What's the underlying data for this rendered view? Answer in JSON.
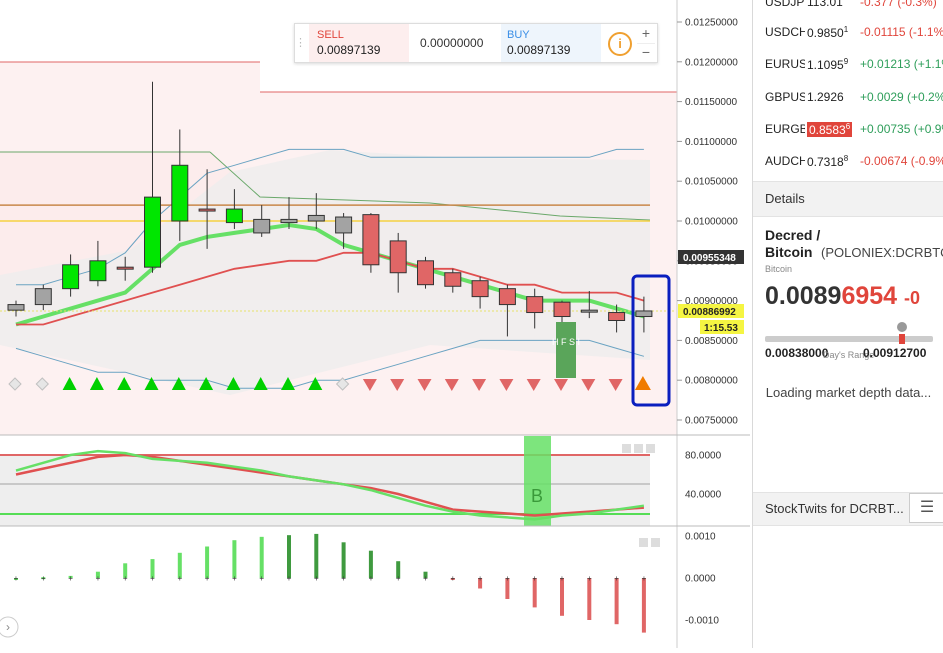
{
  "trade_widget": {
    "sell_label": "SELL",
    "sell_value": "0.00897139",
    "mid_value": "0.00000000",
    "buy_label": "BUY",
    "buy_value": "0.00897139",
    "info_icon": "info-icon",
    "plus": "+",
    "minus": "−"
  },
  "watchlist": [
    {
      "symbol": "USDJPY",
      "last": "113.01",
      "last_sup": "",
      "change": "-0.377 (-0.3%)",
      "dir": "neg",
      "highlight": false
    },
    {
      "symbol": "USDCHF",
      "last": "0.9850",
      "last_sup": "1",
      "change": "-0.01115 (-1.1%)",
      "dir": "neg",
      "highlight": false
    },
    {
      "symbol": "EURUSD",
      "last": "1.1095",
      "last_sup": "9",
      "change": "+0.01213 (+1.1%)",
      "dir": "pos",
      "highlight": false
    },
    {
      "symbol": "GBPUSD",
      "last": "1.2926",
      "last_sup": "",
      "change": "+0.0029 (+0.2%)",
      "dir": "pos",
      "highlight": false
    },
    {
      "symbol": "EURGBP",
      "last": "0.8583",
      "last_sup": "6",
      "change": "+0.00735 (+0.9%)",
      "dir": "pos",
      "highlight": true
    },
    {
      "symbol": "AUDCHF",
      "last": "0.7318",
      "last_sup": "8",
      "change": "-0.00674 (-0.9%)",
      "dir": "neg",
      "highlight": false
    }
  ],
  "details": {
    "header": "Details",
    "title_line1": "Decred /",
    "title_line2": "Bitcoin",
    "exchange": "(POLONIEX:DCRBTC)",
    "subtitle": "Bitcoin",
    "price_main": "0.0089",
    "price_tail": "6954",
    "price_change": "-0",
    "range_low": "0.00838000",
    "range_high": "0.00912700",
    "range_caption": "Day's Range",
    "loading_text": "Loading market depth data..."
  },
  "stocktwits": {
    "header": "StockTwits for DCRBT...",
    "list_icon": "list-icon"
  },
  "price_axis": {
    "labels": [
      "0.01250000",
      "0.01200000",
      "0.01150000",
      "0.01100000",
      "0.01050000",
      "0.01000000",
      "0.00950000",
      "0.00900000",
      "0.00850000",
      "0.00800000",
      "0.00750000"
    ],
    "tag_upper": "0.00955348",
    "tag_current": "0.00886992",
    "tag_countdown": "1:15.53"
  },
  "osc_axis": {
    "labels": [
      "80.0000",
      "40.0000"
    ],
    "panel_letter": "B"
  },
  "macd_axis": {
    "labels": [
      "0.0010",
      "0.0000",
      "-0.0010"
    ]
  },
  "hfsi_label": "H F S I",
  "colors": {
    "up": "#00e600",
    "down": "#e06666",
    "neutral": "#a3a3a3",
    "ma_green": "#66e066",
    "ma_red": "#e05050",
    "band_blue": "#6aa3c2",
    "highlight_box": "#0a1fbf",
    "price_tag": "#f5f542"
  },
  "chart_data": [
    {
      "type": "candlestick",
      "title": "",
      "ylim": [
        0.0073,
        0.0129
      ],
      "y_ticks": [
        0.0125,
        0.012,
        0.0115,
        0.011,
        0.0105,
        0.01,
        0.0095,
        0.009,
        0.0085,
        0.008,
        0.0075
      ],
      "candles": [
        {
          "o": 0.00888,
          "h": 0.009,
          "l": 0.0088,
          "c": 0.00895,
          "color": "neutral"
        },
        {
          "o": 0.00895,
          "h": 0.0092,
          "l": 0.00888,
          "c": 0.00915,
          "color": "neutral"
        },
        {
          "o": 0.00915,
          "h": 0.00958,
          "l": 0.00905,
          "c": 0.00945,
          "color": "up"
        },
        {
          "o": 0.00925,
          "h": 0.00975,
          "l": 0.00918,
          "c": 0.0095,
          "color": "up"
        },
        {
          "o": 0.0094,
          "h": 0.00955,
          "l": 0.00925,
          "c": 0.00942,
          "color": "down"
        },
        {
          "o": 0.00942,
          "h": 0.01175,
          "l": 0.00935,
          "c": 0.0103,
          "color": "up"
        },
        {
          "o": 0.01,
          "h": 0.01115,
          "l": 0.00975,
          "c": 0.0107,
          "color": "up"
        },
        {
          "o": 0.01015,
          "h": 0.01065,
          "l": 0.00965,
          "c": 0.01015,
          "color": "down"
        },
        {
          "o": 0.01015,
          "h": 0.0104,
          "l": 0.0099,
          "c": 0.00998,
          "color": "up"
        },
        {
          "o": 0.01002,
          "h": 0.0102,
          "l": 0.0098,
          "c": 0.00985,
          "color": "neutral"
        },
        {
          "o": 0.00998,
          "h": 0.0103,
          "l": 0.0099,
          "c": 0.01002,
          "color": "neutral"
        },
        {
          "o": 0.01,
          "h": 0.01035,
          "l": 0.0099,
          "c": 0.01007,
          "color": "neutral"
        },
        {
          "o": 0.01005,
          "h": 0.0101,
          "l": 0.00965,
          "c": 0.00985,
          "color": "neutral"
        },
        {
          "o": 0.01008,
          "h": 0.0101,
          "l": 0.00935,
          "c": 0.00945,
          "color": "down"
        },
        {
          "o": 0.00975,
          "h": 0.00985,
          "l": 0.0091,
          "c": 0.00935,
          "color": "down"
        },
        {
          "o": 0.0095,
          "h": 0.00955,
          "l": 0.00915,
          "c": 0.0092,
          "color": "down"
        },
        {
          "o": 0.00935,
          "h": 0.0094,
          "l": 0.0091,
          "c": 0.00918,
          "color": "down"
        },
        {
          "o": 0.00925,
          "h": 0.0093,
          "l": 0.0089,
          "c": 0.00905,
          "color": "down"
        },
        {
          "o": 0.00915,
          "h": 0.0092,
          "l": 0.00855,
          "c": 0.00895,
          "color": "down"
        },
        {
          "o": 0.00905,
          "h": 0.00915,
          "l": 0.00865,
          "c": 0.00885,
          "color": "down"
        },
        {
          "o": 0.00898,
          "h": 0.009,
          "l": 0.0087,
          "c": 0.0088,
          "color": "down"
        },
        {
          "o": 0.00888,
          "h": 0.00912,
          "l": 0.00878,
          "c": 0.00886,
          "color": "neutral"
        },
        {
          "o": 0.00885,
          "h": 0.00895,
          "l": 0.0086,
          "c": 0.00875,
          "color": "down"
        },
        {
          "o": 0.0088,
          "h": 0.00905,
          "l": 0.0086,
          "c": 0.00887,
          "color": "neutral"
        }
      ],
      "series": [
        {
          "values": [
            0.0087,
            0.0088,
            0.0089,
            0.009,
            0.0091,
            0.0094,
            0.0097,
            0.0098,
            0.00985,
            0.0099,
            0.00995,
            0.0099,
            0.0097,
            0.0096,
            0.0095,
            0.0094,
            0.0093,
            0.0092,
            0.0091,
            0.009,
            0.009,
            0.009,
            0.0089,
            0.0088
          ],
          "color": "ma_green"
        },
        {
          "values": [
            0.0087,
            0.0087,
            0.0088,
            0.0089,
            0.009,
            0.0091,
            0.0092,
            0.0093,
            0.0094,
            0.00945,
            0.0095,
            0.0095,
            0.0096,
            0.0096,
            0.0095,
            0.0094,
            0.0094,
            0.0093,
            0.0092,
            0.0092,
            0.0091,
            0.0091,
            0.0091,
            0.009
          ],
          "color": "ma_red"
        },
        {
          "values": [
            0.0092,
            0.0092,
            0.0093,
            0.0094,
            0.0096,
            0.01,
            0.0103,
            0.0106,
            0.0107,
            0.0108,
            0.0109,
            0.0109,
            0.0109,
            0.0108,
            0.0108,
            0.0108,
            0.0108,
            0.0108,
            0.0108,
            0.0108,
            0.0108,
            0.0108,
            0.0109,
            0.0109
          ],
          "color": "band_blue"
        },
        {
          "values": [
            0.0084,
            0.0083,
            0.0082,
            0.0081,
            0.0081,
            0.008,
            0.008,
            0.008,
            0.0079,
            0.0079,
            0.0079,
            0.008,
            0.008,
            0.0081,
            0.0082,
            0.0083,
            0.0084,
            0.0085,
            0.0085,
            0.0085,
            0.0085,
            0.0085,
            0.0084,
            0.0083
          ],
          "color": "band_blue"
        }
      ],
      "markers": [
        "diamond",
        "diamond",
        "up",
        "up",
        "up",
        "up",
        "up",
        "up",
        "up",
        "up",
        "up",
        "up",
        "diamond",
        "down",
        "down",
        "down",
        "down",
        "down",
        "down",
        "down",
        "down",
        "down",
        "down",
        "up-orange"
      ],
      "levels": [
        0.0102,
        0.01
      ]
    },
    {
      "type": "line",
      "title": "",
      "ylim": [
        20,
        100
      ],
      "y_ticks": [
        80,
        40
      ],
      "series": [
        {
          "values": [
            60,
            66,
            72,
            78,
            80,
            78,
            74,
            70,
            66,
            62,
            58,
            54,
            50,
            46,
            40,
            32,
            24,
            22,
            20,
            18,
            20,
            22,
            24,
            26
          ],
          "color": "ma_red"
        },
        {
          "values": [
            64,
            72,
            80,
            84,
            82,
            76,
            74,
            72,
            68,
            64,
            58,
            54,
            50,
            44,
            36,
            28,
            22,
            18,
            16,
            14,
            18,
            20,
            24,
            28
          ],
          "color": "ma_green"
        }
      ]
    },
    {
      "type": "bar",
      "title": "",
      "ylim": [
        -0.0014,
        0.0012
      ],
      "y_ticks": [
        0.001,
        0.0,
        -0.001
      ],
      "values": [
        0.0,
        2e-05,
        5e-05,
        0.00015,
        0.00035,
        0.00045,
        0.0006,
        0.00075,
        0.0009,
        0.00098,
        0.00102,
        0.00105,
        0.00085,
        0.00065,
        0.0004,
        0.00015,
        -3e-05,
        -0.00025,
        -0.0005,
        -0.0007,
        -0.0009,
        -0.001,
        -0.0011,
        -0.0013
      ]
    }
  ]
}
